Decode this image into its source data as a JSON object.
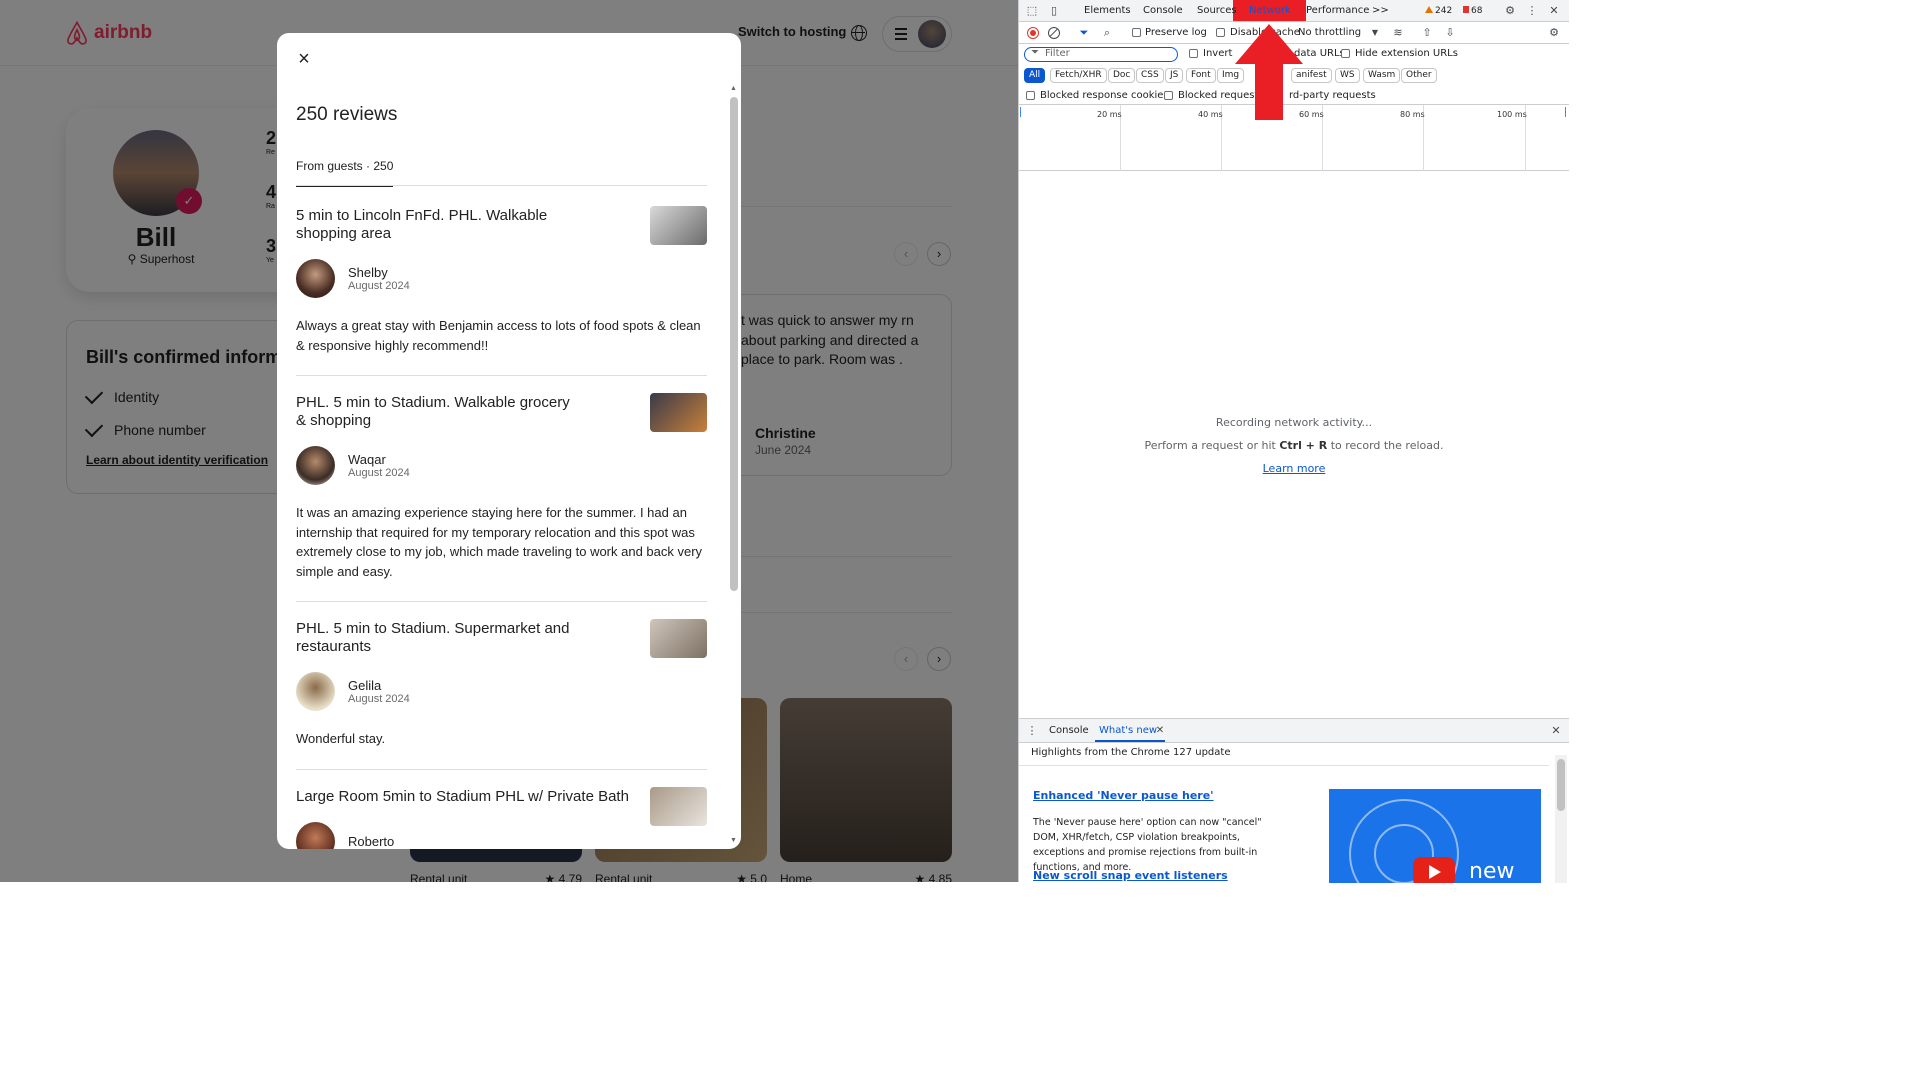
{
  "site": {
    "brand": "airbnb",
    "switch_hosting": "Switch to hosting",
    "profile": {
      "name": "Bill",
      "badge": "Superhost",
      "stats": [
        {
          "value": "2",
          "label": "Re"
        },
        {
          "value": "4",
          "label": "Ra"
        },
        {
          "value": "3",
          "label": "Ye"
        }
      ]
    },
    "confirmed": {
      "title": "Bill's confirmed informa",
      "items": [
        "Identity",
        "Phone number"
      ],
      "link": "Learn about identity verification"
    },
    "background_review": {
      "text": "t was quick to answer my rn about parking and directed a place to park. Room was .",
      "name": "Christine",
      "date": "June 2024"
    },
    "listings": [
      {
        "type": "Rental unit",
        "rating": "★ 4.79"
      },
      {
        "type": "Rental unit",
        "rating": "★ 5.0"
      },
      {
        "type": "Home",
        "rating": "★ 4.85"
      }
    ]
  },
  "modal": {
    "close_label": "×",
    "title": "250 reviews",
    "tab": "From guests · 250",
    "reviews": [
      {
        "listing": "5 min to Lincoln FnFd. PHL. Walkable shopping area",
        "name": "Shelby",
        "date": "August 2024",
        "text": "Always a great stay with Benjamin access to lots of food spots & clean & responsive highly recommend!!"
      },
      {
        "listing": "PHL. 5 min to Stadium. Walkable grocery & shopping",
        "name": "Waqar",
        "date": "August 2024",
        "text": "It was an amazing experience staying here for the summer. I had an internship that required for my temporary relocation and this spot was extremely close to my job, which made traveling to work and back very simple and easy."
      },
      {
        "listing": "PHL. 5 min to Stadium. Supermarket and restaurants",
        "name": "Gelila",
        "date": "August 2024",
        "text": "Wonderful stay."
      },
      {
        "listing": "Large Room 5min to Stadium PHL w/ Private Bath",
        "name": "Roberto",
        "date": "",
        "text": ""
      }
    ]
  },
  "devtools": {
    "tabs": [
      "Elements",
      "Console",
      "Sources",
      "Network",
      "Performance"
    ],
    "more": ">>",
    "warnings": "242",
    "errors": "68",
    "toolbar": {
      "preserve_log": "Preserve log",
      "disable_cache": "Disable cache",
      "throttling": "No throttling"
    },
    "filter": {
      "placeholder": "Filter",
      "invert": "Invert",
      "hide_data": "data URLs",
      "hide_ext": "Hide extension URLs"
    },
    "types": [
      "All",
      "Fetch/XHR",
      "Doc",
      "CSS",
      "JS",
      "Font",
      "Img",
      "Manifest",
      "WS",
      "Wasm",
      "Other"
    ],
    "type_labels_visible": [
      "All",
      "Fetch/XHR",
      "Doc",
      "CSS",
      "JS",
      "Font",
      "Img",
      "anifest",
      "WS",
      "Wasm",
      "Other"
    ],
    "blocked_cookies": "Blocked response cookies",
    "blocked_requests": "Blocked requests",
    "third_party": "rd-party requests",
    "timeline_ticks": [
      "20 ms",
      "40 ms",
      "60 ms",
      "80 ms",
      "100 ms"
    ],
    "empty": {
      "line1": "Recording network activity...",
      "line2_pre": "Perform a request or hit ",
      "line2_key": "Ctrl + R",
      "line2_post": " to record the reload.",
      "link": "Learn more"
    },
    "drawer": {
      "tabs": [
        "Console",
        "What's new"
      ],
      "heading": "Highlights from the Chrome 127 update",
      "items": [
        {
          "title": "Enhanced 'Never pause here'",
          "desc": "The 'Never pause here' option can now \"cancel\" DOM, XHR/fetch, CSP violation breakpoints, exceptions and promise rejections from built-in functions, and more."
        },
        {
          "title": "New scroll snap event listeners",
          "desc": ""
        }
      ],
      "video_label": "new"
    }
  },
  "colors": {
    "brand": "#ff385c",
    "superhost_badge": "#e31c5f",
    "devtools_accent": "#0b57d0",
    "highlight_red": "#ea1f25"
  }
}
